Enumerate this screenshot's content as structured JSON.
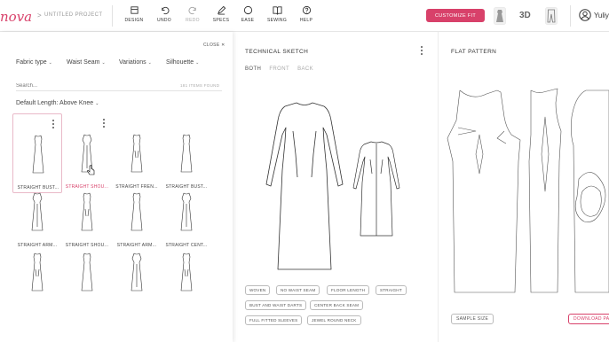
{
  "brand": {
    "logo_text": "nova",
    "color": "#d8416a"
  },
  "breadcrumb": {
    "separator": ">",
    "project": "UNTITLED PROJECT"
  },
  "toolbar": {
    "design": "DESIGN",
    "undo": "UNDO",
    "redo": "REDO",
    "specs": "SPECS",
    "ease": "EASE",
    "sewing": "SEWING",
    "help": "HELP",
    "customize": "CUSTOMIZE FIT",
    "view_3d": "3D"
  },
  "user": {
    "name": "Yuliya"
  },
  "left_panel": {
    "close": "CLOSE",
    "filters": [
      "Fabric type",
      "Waist Seam",
      "Variations",
      "Silhouette"
    ],
    "search_placeholder": "Search...",
    "count": "181 ITEMS FOUND",
    "default_length": "Default Length: Above Knee",
    "items": [
      {
        "name": "STRAIGHT BUST...",
        "selected": true
      },
      {
        "name": "STRAIGHT SHOU...",
        "hovered": true
      },
      {
        "name": "STRAIGHT FREN..."
      },
      {
        "name": "STRAIGHT BUST..."
      },
      {
        "name": "STRAIGHT ARM..."
      },
      {
        "name": "STRAIGHT SHOU..."
      },
      {
        "name": "STRAIGHT ARM..."
      },
      {
        "name": "STRAIGHT CENT..."
      },
      {
        "name": ""
      },
      {
        "name": ""
      },
      {
        "name": ""
      },
      {
        "name": ""
      }
    ]
  },
  "technical_sketch": {
    "title": "TECHNICAL SKETCH",
    "views": [
      "BOTH",
      "FRONT",
      "BACK"
    ],
    "active_view": "BOTH",
    "tags": [
      "WOVEN",
      "NO WAIST SEAM",
      "FLOOR LENGTH",
      "STRAIGHT",
      "BUST AND WAIST DARTS",
      "CENTER BACK SEAM",
      "FULL FITTED SLEEVES",
      "JEWEL ROUND NECK"
    ]
  },
  "flat_pattern": {
    "title": "FLAT PATTERN",
    "sample_size": "SAMPLE SIZE",
    "download": "DOWNLOAD PATTERN"
  }
}
